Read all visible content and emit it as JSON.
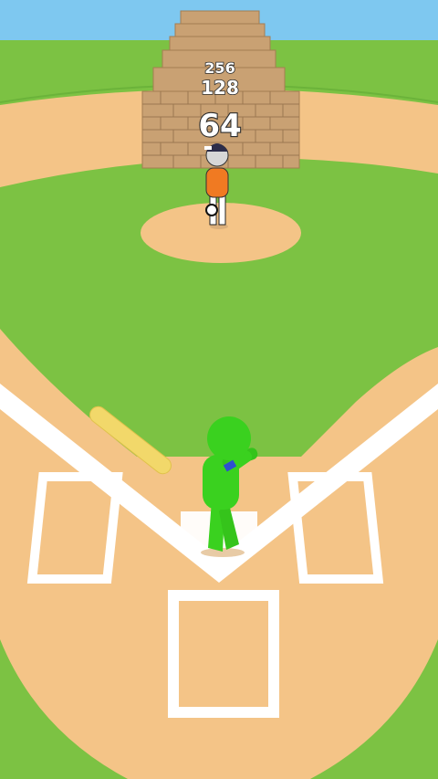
{
  "game": {
    "colors": {
      "sky": "#7ec8f0",
      "grass": "#7cc243",
      "dirt": "#f4c487",
      "chalk": "#ffffff",
      "brick": "#c9a173",
      "player": "#3ad11f",
      "bat": "#f2d86a",
      "pitcher_shirt": "#f07a22"
    },
    "walls": [
      {
        "value": "64",
        "visible": "full"
      },
      {
        "value": "128",
        "visible": "partial"
      },
      {
        "value": "256",
        "visible": "partial"
      }
    ],
    "player": {
      "role": "batter",
      "icon": "stickman-batter-icon"
    },
    "pitcher": {
      "role": "pitcher",
      "icon": "stickman-pitcher-icon"
    }
  }
}
